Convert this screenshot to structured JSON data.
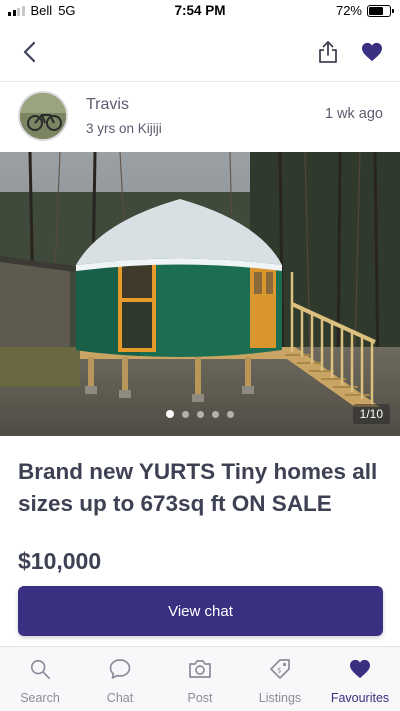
{
  "status_bar": {
    "carrier": "Bell",
    "network": "5G",
    "time": "7:54 PM",
    "battery": "72%",
    "battery_level": 0.72
  },
  "nav": {
    "back_icon": "chevron-left-icon",
    "share_icon": "share-icon",
    "favourite_icon": "heart-filled-icon"
  },
  "seller": {
    "name": "Travis",
    "membership": "3 yrs on Kijiji",
    "posted": "1 wk  ago"
  },
  "photo": {
    "counter": "1/10",
    "dots": [
      true,
      false,
      false,
      false,
      false
    ]
  },
  "listing": {
    "title": "Brand new YURTS Tiny homes all sizes up to 673sq ft ON SALE",
    "price": "$10,000"
  },
  "cta": {
    "label": "View chat"
  },
  "tabbar": {
    "items": [
      {
        "label": "Search",
        "icon": "search-icon",
        "active": false
      },
      {
        "label": "Chat",
        "icon": "chat-bubble-icon",
        "active": false
      },
      {
        "label": "Post",
        "icon": "camera-icon",
        "active": false
      },
      {
        "label": "Listings",
        "icon": "tag-icon",
        "active": false
      },
      {
        "label": "Favourites",
        "icon": "heart-icon",
        "active": true
      }
    ]
  },
  "colors": {
    "accent": "#3a3081",
    "text": "#3e4153",
    "muted": "#8b8d9a"
  }
}
